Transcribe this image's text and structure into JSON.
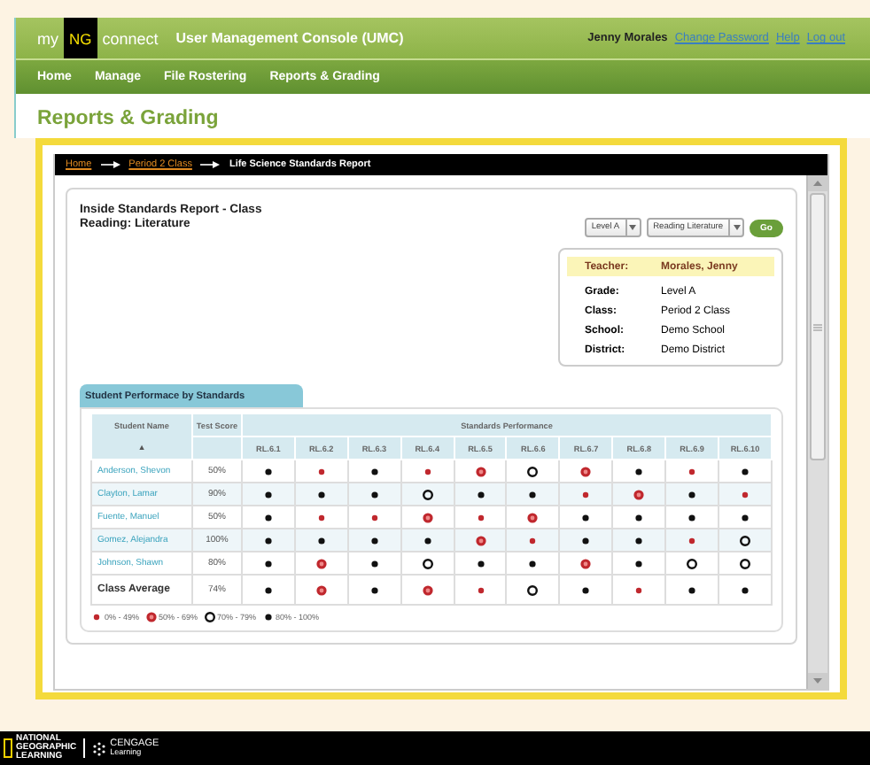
{
  "header": {
    "logo": {
      "my": "my",
      "ng": "NG",
      "connect": "connect"
    },
    "title": "User Management Console (UMC)",
    "user": "Jenny Morales",
    "links": [
      "Change Password",
      "Help",
      "Log out"
    ]
  },
  "nav": [
    "Home",
    "Manage",
    "File Rostering",
    "Reports & Grading"
  ],
  "page_title": "Reports & Grading",
  "breadcrumb": [
    {
      "label": "Home",
      "link": true
    },
    {
      "label": "Period 2 Class",
      "link": true
    },
    {
      "label": "Life Science Standards Report",
      "link": false
    }
  ],
  "report": {
    "title": "Inside Standards Report - Class",
    "subtitle": "Reading: Literature",
    "selects": [
      "Level A",
      "Reading Literature"
    ],
    "go": "Go",
    "info": [
      {
        "label": "Teacher:",
        "value": "Morales, Jenny",
        "highlight": true
      },
      {
        "label": "Grade:",
        "value": "Level A",
        "highlight": false
      },
      {
        "label": "Class:",
        "value": "Period 2 Class",
        "highlight": false
      },
      {
        "label": "School:",
        "value": "Demo School",
        "highlight": false
      },
      {
        "label": "District:",
        "value": "Demo District",
        "highlight": false
      }
    ]
  },
  "tab": "Student Performace by Standards",
  "table": {
    "columns": [
      "Student Name",
      "Test Score",
      "Standards Performance"
    ],
    "sort_icon": "▲",
    "standards": [
      "RL.6.1",
      "RL.6.2",
      "RL.6.3",
      "RL.6.4",
      "RL.6.5",
      "RL.6.6",
      "RL.6.7",
      "RL.6.8",
      "RL.6.9",
      "RL.6.10"
    ],
    "rows": [
      {
        "name": "Anderson, Shevon",
        "score": "50%",
        "kind": "student",
        "marks": [
          {
            "kind": "high"
          },
          {
            "kind": "low"
          },
          {
            "kind": "high"
          },
          {
            "kind": "low"
          },
          {
            "kind": "mid"
          },
          {
            "kind": "fair"
          },
          {
            "kind": "mid"
          },
          {
            "kind": "high"
          },
          {
            "kind": "low"
          },
          {
            "kind": "high"
          }
        ]
      },
      {
        "name": "Clayton, Lamar",
        "score": "90%",
        "kind": "student",
        "marks": [
          {
            "kind": "high"
          },
          {
            "kind": "high"
          },
          {
            "kind": "high"
          },
          {
            "kind": "fair"
          },
          {
            "kind": "high"
          },
          {
            "kind": "high"
          },
          {
            "kind": "low"
          },
          {
            "kind": "mid"
          },
          {
            "kind": "high"
          },
          {
            "kind": "low"
          }
        ]
      },
      {
        "name": "Fuente, Manuel",
        "score": "50%",
        "kind": "student",
        "marks": [
          {
            "kind": "high"
          },
          {
            "kind": "low"
          },
          {
            "kind": "low"
          },
          {
            "kind": "mid"
          },
          {
            "kind": "low"
          },
          {
            "kind": "mid"
          },
          {
            "kind": "high"
          },
          {
            "kind": "high"
          },
          {
            "kind": "high"
          },
          {
            "kind": "high"
          }
        ]
      },
      {
        "name": "Gomez, Alejandra",
        "score": "100%",
        "kind": "student",
        "marks": [
          {
            "kind": "high"
          },
          {
            "kind": "high"
          },
          {
            "kind": "high"
          },
          {
            "kind": "high"
          },
          {
            "kind": "mid"
          },
          {
            "kind": "low"
          },
          {
            "kind": "high"
          },
          {
            "kind": "high"
          },
          {
            "kind": "low"
          },
          {
            "kind": "fair"
          }
        ]
      },
      {
        "name": "Johnson, Shawn",
        "score": "80%",
        "kind": "student",
        "marks": [
          {
            "kind": "high"
          },
          {
            "kind": "mid"
          },
          {
            "kind": "high"
          },
          {
            "kind": "fair"
          },
          {
            "kind": "high"
          },
          {
            "kind": "high"
          },
          {
            "kind": "mid"
          },
          {
            "kind": "high"
          },
          {
            "kind": "fair"
          },
          {
            "kind": "fair"
          }
        ]
      },
      {
        "name": "Class Average",
        "score": "74%",
        "kind": "average",
        "marks": [
          {
            "kind": "high"
          },
          {
            "kind": "mid"
          },
          {
            "kind": "high"
          },
          {
            "kind": "mid"
          },
          {
            "kind": "low"
          },
          {
            "kind": "fair"
          },
          {
            "kind": "high"
          },
          {
            "kind": "low"
          },
          {
            "kind": "high"
          },
          {
            "kind": "high"
          }
        ]
      }
    ]
  },
  "legend": [
    {
      "kind": "low",
      "label": "0% - 49%"
    },
    {
      "kind": "mid",
      "label": "50% - 69%"
    },
    {
      "kind": "fair",
      "label": "70% - 79%"
    },
    {
      "kind": "high",
      "label": "80% - 100%"
    }
  ],
  "footer": {
    "brand1": [
      "NATIONAL",
      "GEOGRAPHIC",
      "LEARNING"
    ],
    "brand2": [
      "CENGAGE",
      "Learning"
    ]
  }
}
